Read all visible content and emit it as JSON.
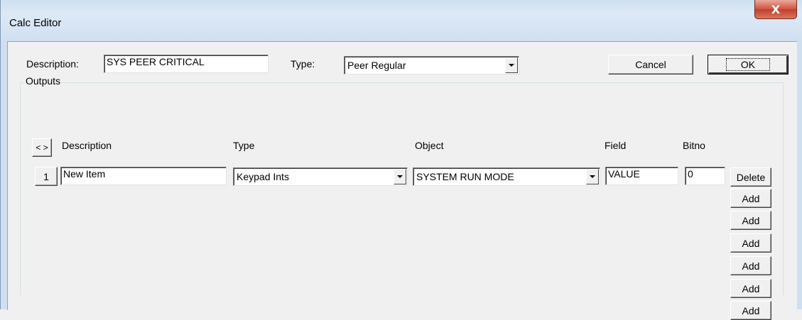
{
  "window": {
    "title": "Calc Editor",
    "close_glyph": "X"
  },
  "form": {
    "description_label": "Description:",
    "description_value": "SYS PEER CRITICAL",
    "type_label": "Type:",
    "type_value": "Peer Regular",
    "cancel_label": "Cancel",
    "ok_label": "OK"
  },
  "outputs": {
    "group_label": "Outputs",
    "toggle_label": "< >",
    "columns": {
      "description": "Description",
      "type": "Type",
      "object": "Object",
      "field": "Field",
      "bitno": "Bitno"
    },
    "rows": [
      {
        "index": "1",
        "description": "New Item",
        "type": "Keypad Ints",
        "object": "SYSTEM RUN MODE",
        "field": "VALUE",
        "bitno": "0",
        "delete_label": "Delete"
      }
    ],
    "add_buttons": [
      "Add",
      "Add",
      "Add",
      "Add",
      "Add",
      "Add"
    ]
  },
  "colors": {
    "title_gradient_top": "#cfe0f1",
    "close_button": "#c94a36",
    "dialog_background": "#f0f0f0"
  }
}
